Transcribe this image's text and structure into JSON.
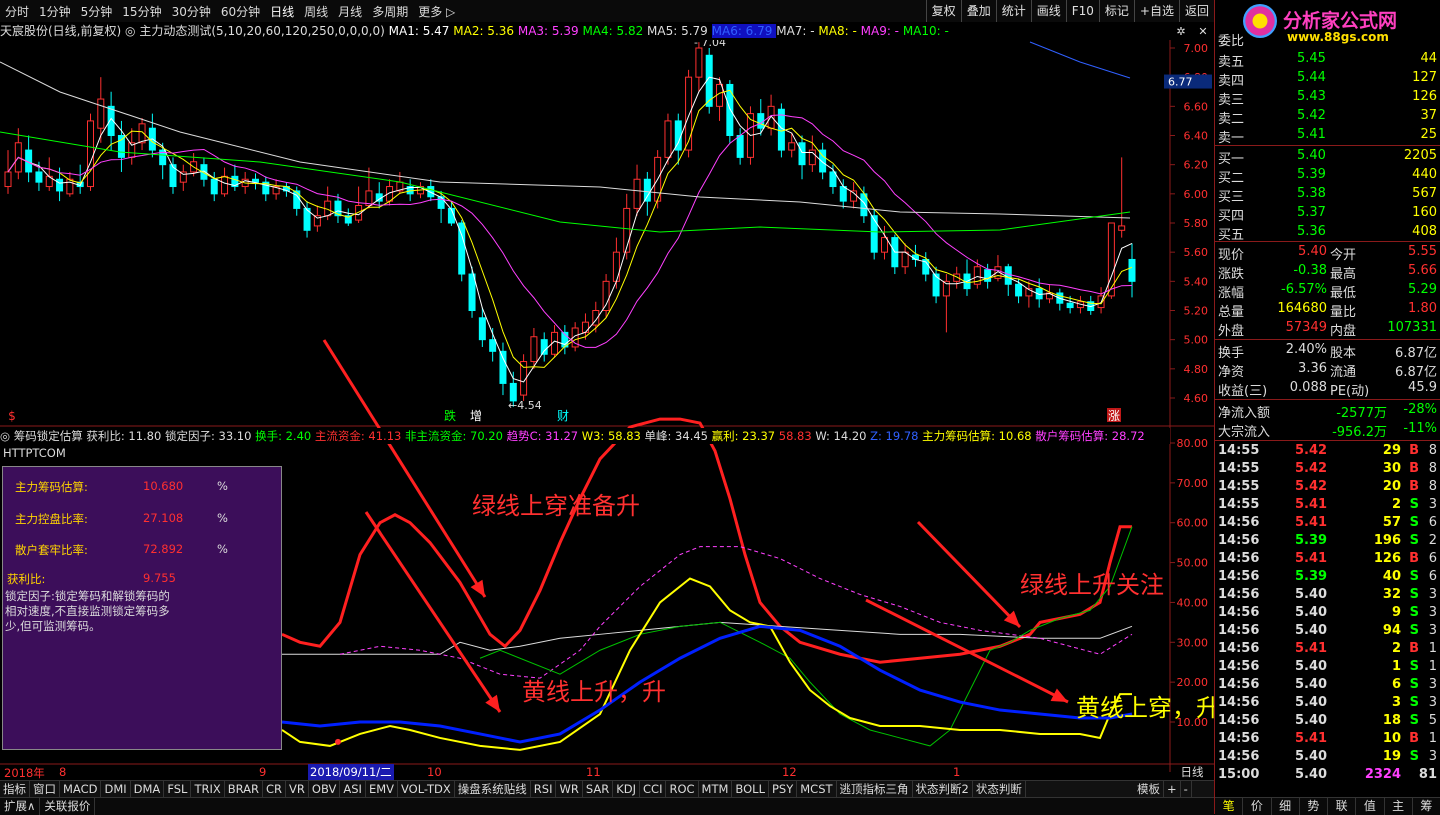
{
  "toolbar": {
    "left_items": [
      "分时",
      "1分钟",
      "5分钟",
      "15分钟",
      "30分钟",
      "60分钟",
      "日线",
      "周线",
      "月线",
      "多周期",
      "更多 ▷"
    ],
    "active": "日线",
    "right_items": [
      "复权",
      "叠加",
      "统计",
      "画线",
      "F10",
      "标记",
      "+自选",
      "返回"
    ]
  },
  "main_header": {
    "stock": "天宸股份(日线,前复权)",
    "indicator": "主力动态测试(5,10,20,60,120,250,0,0,0,0)",
    "ma": [
      {
        "label": "MA1: 5.47",
        "color": "#ffffff"
      },
      {
        "label": "MA2: 5.36",
        "color": "#ffff00"
      },
      {
        "label": "MA3: 5.39",
        "color": "#ff40ff"
      },
      {
        "label": "MA4: 5.82",
        "color": "#00ff00"
      },
      {
        "label": "MA5: 5.79",
        "color": "#dcdcdc"
      },
      {
        "label": "MA6: 6.79",
        "color": "#3060ff"
      },
      {
        "label": "MA7: -",
        "color": "#dcdcdc"
      },
      {
        "label": "MA8: -",
        "color": "#ffff00"
      },
      {
        "label": "MA9: -",
        "color": "#ff40ff"
      },
      {
        "label": "MA10: -",
        "color": "#00ff00"
      }
    ]
  },
  "price_axis": [
    "7.00",
    "6.80",
    "6.60",
    "6.40",
    "6.20",
    "6.00",
    "5.80",
    "5.60",
    "5.40",
    "5.20",
    "5.00",
    "4.80",
    "4.60"
  ],
  "price_marker": "6.77",
  "chart_labels": {
    "high": "7.04",
    "low": "4.54"
  },
  "chart_marks": [
    {
      "text": "$",
      "color": "#ff3030"
    },
    {
      "text": "跌",
      "color": "#00ff00"
    },
    {
      "text": "增",
      "color": "#ffffff"
    },
    {
      "text": "财",
      "color": "#00ffff"
    },
    {
      "text": "涨",
      "color": "#ffffff"
    }
  ],
  "sub_header": {
    "name": "筹码锁定估算",
    "items": [
      {
        "label": "获利比: 11.80",
        "color": "#dcdcdc"
      },
      {
        "label": "锁定因子: 33.10",
        "color": "#dcdcdc"
      },
      {
        "label": "换手: 2.40",
        "color": "#00ff00"
      },
      {
        "label": "主流资金: 41.13",
        "color": "#ff3030"
      },
      {
        "label": "非主流资金: 70.20",
        "color": "#00ff00"
      },
      {
        "label": "趋势C: 31.27",
        "color": "#ff40ff"
      },
      {
        "label": "W3: 58.83",
        "color": "#ffff00"
      },
      {
        "label": "单峰: 34.45",
        "color": "#dcdcdc"
      },
      {
        "label": "赢利: 23.37",
        "color": "#ffff00"
      },
      {
        "label": "58.83",
        "color": "#ff3030"
      },
      {
        "label": "W: 14.20",
        "color": "#dcdcdc"
      },
      {
        "label": "Z: 19.78",
        "color": "#3060ff"
      },
      {
        "label": "主力筹码估算: 10.68",
        "color": "#ffff00"
      },
      {
        "label": "散户筹码估算: 28.72",
        "color": "#ff40ff"
      }
    ],
    "sub_label": "HTTPTCOM"
  },
  "sub_axis": [
    "80.00",
    "70.00",
    "60.00",
    "50.00",
    "40.00",
    "30.00",
    "20.00",
    "10.00"
  ],
  "infobox": {
    "rows": [
      {
        "label": "主力筹码估算:",
        "value": "10.680",
        "pct": "%"
      },
      {
        "label": "主力控盘比率:",
        "value": "27.108",
        "pct": "%"
      },
      {
        "label": "散户套牢比率:",
        "value": "72.892",
        "pct": "%"
      }
    ],
    "profit_label": "获利比:",
    "profit_value": "9.755",
    "note": "锁定因子:锁定筹码和解锁筹码的相对速度,不直接监测锁定筹码多少,但可监测筹码。"
  },
  "annotations": [
    {
      "text": "绿线上穿准备升",
      "color": "#ff3030"
    },
    {
      "text": "黄线上升，升",
      "color": "#ff3030"
    },
    {
      "text": "绿线上升关注",
      "color": "#ff3030"
    },
    {
      "text": "黄线上穿，升！",
      "color": "#ffff00"
    }
  ],
  "date_axis": [
    "2018年",
    "8",
    "9",
    "2018/09/11/二",
    "10",
    "11",
    "12",
    "1"
  ],
  "period_label": "日线",
  "indicator_tabs": [
    "指标",
    "窗口",
    "MACD",
    "DMI",
    "DMA",
    "FSL",
    "TRIX",
    "BRAR",
    "CR",
    "VR",
    "OBV",
    "ASI",
    "EMV",
    "VOL-TDX",
    "操盘系统贴线",
    "RSI",
    "WR",
    "SAR",
    "KDJ",
    "CCI",
    "ROC",
    "MTM",
    "BOLL",
    "PSY",
    "MCST",
    "逃顶指标三角",
    "状态判断2",
    "状态判断"
  ],
  "tab_right": [
    "模板",
    "+",
    "-"
  ],
  "bottom_tabs": [
    "扩展∧",
    "关联报价"
  ],
  "logo": {
    "brand": "分析家公式网",
    "url": "www.88gs.com"
  },
  "right_panel": {
    "committee_label": "委比",
    "asks": [
      {
        "label": "卖五",
        "price": "5.45",
        "vol": "44"
      },
      {
        "label": "卖四",
        "price": "5.44",
        "vol": "127"
      },
      {
        "label": "卖三",
        "price": "5.43",
        "vol": "126"
      },
      {
        "label": "卖二",
        "price": "5.42",
        "vol": "37"
      },
      {
        "label": "卖一",
        "price": "5.41",
        "vol": "25"
      }
    ],
    "bids": [
      {
        "label": "买一",
        "price": "5.40",
        "vol": "2205"
      },
      {
        "label": "买二",
        "price": "5.39",
        "vol": "440"
      },
      {
        "label": "买三",
        "price": "5.38",
        "vol": "567"
      },
      {
        "label": "买四",
        "price": "5.37",
        "vol": "160"
      },
      {
        "label": "买五",
        "price": "5.36",
        "vol": "408"
      }
    ],
    "quote": [
      {
        "l1": "现价",
        "v1": "5.40",
        "c1": "#ff3030",
        "l2": "今开",
        "v2": "5.55",
        "c2": "#ff3030"
      },
      {
        "l1": "涨跌",
        "v1": "-0.38",
        "c1": "#00ff00",
        "l2": "最高",
        "v2": "5.66",
        "c2": "#ff3030"
      },
      {
        "l1": "涨幅",
        "v1": "-6.57%",
        "c1": "#00ff00",
        "l2": "最低",
        "v2": "5.29",
        "c2": "#00ff00"
      },
      {
        "l1": "总量",
        "v1": "164680",
        "c1": "#ffff00",
        "l2": "量比",
        "v2": "1.80",
        "c2": "#ff3030"
      },
      {
        "l1": "外盘",
        "v1": "57349",
        "c1": "#ff3030",
        "l2": "内盘",
        "v2": "107331",
        "c2": "#00ff00"
      }
    ],
    "fund": [
      {
        "l1": "换手",
        "v1": "2.40%",
        "l2": "股本",
        "v2": "6.87亿"
      },
      {
        "l1": "净资",
        "v1": "3.36",
        "l2": "流通",
        "v2": "6.87亿"
      },
      {
        "l1": "收益(三)",
        "v1": "0.088",
        "l2": "PE(动)",
        "v2": "45.9"
      }
    ],
    "flows": [
      {
        "label": "净流入额",
        "v1": "-2577万",
        "v2": "-28%"
      },
      {
        "label": "大宗流入",
        "v1": "-956.2万",
        "v2": "-11%"
      }
    ],
    "ticks": [
      {
        "t": "14:55",
        "p": "5.42",
        "v": "29",
        "s": "B"
      },
      {
        "t": "14:55",
        "p": "5.42",
        "v": "30",
        "s": "B"
      },
      {
        "t": "14:55",
        "p": "5.42",
        "v": "20",
        "s": "B"
      },
      {
        "t": "14:55",
        "p": "5.41",
        "v": "2",
        "s": "S"
      },
      {
        "t": "14:56",
        "p": "5.41",
        "v": "57",
        "s": "S"
      },
      {
        "t": "14:56",
        "p": "5.39",
        "v": "196",
        "s": "S"
      },
      {
        "t": "14:56",
        "p": "5.41",
        "v": "126",
        "s": "B"
      },
      {
        "t": "14:56",
        "p": "5.39",
        "v": "40",
        "s": "S"
      },
      {
        "t": "14:56",
        "p": "5.40",
        "v": "32",
        "s": "S"
      },
      {
        "t": "14:56",
        "p": "5.40",
        "v": "9",
        "s": "S"
      },
      {
        "t": "14:56",
        "p": "5.40",
        "v": "94",
        "s": "S"
      },
      {
        "t": "14:56",
        "p": "5.41",
        "v": "2",
        "s": "B"
      },
      {
        "t": "14:56",
        "p": "5.40",
        "v": "1",
        "s": "S"
      },
      {
        "t": "14:56",
        "p": "5.40",
        "v": "6",
        "s": "S"
      },
      {
        "t": "14:56",
        "p": "5.40",
        "v": "3",
        "s": "S"
      },
      {
        "t": "14:56",
        "p": "5.40",
        "v": "18",
        "s": "S"
      },
      {
        "t": "14:56",
        "p": "5.41",
        "v": "10",
        "s": "B"
      },
      {
        "t": "14:56",
        "p": "5.40",
        "v": "19",
        "s": "S"
      },
      {
        "t": "15:00",
        "p": "5.40",
        "v": "2324",
        "s": "81"
      }
    ],
    "tick_suffix": [
      "8",
      "8",
      "8",
      "3",
      "6",
      "2",
      "6",
      "6",
      "3",
      "3",
      "3",
      "1",
      "1",
      "3",
      "3",
      "5",
      "1",
      "3"
    ],
    "bottom_tabs": [
      "笔",
      "价",
      "细",
      "势",
      "联",
      "值",
      "主",
      "筹"
    ]
  }
}
